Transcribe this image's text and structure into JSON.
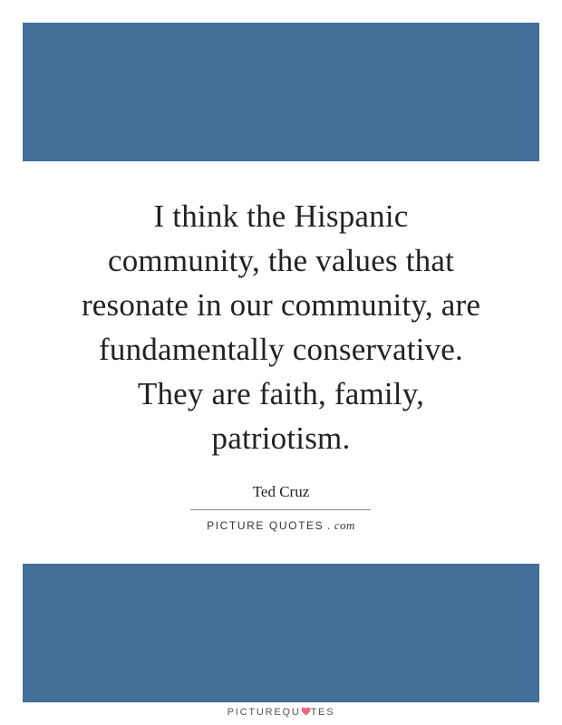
{
  "colors": {
    "band": "#446f99",
    "heart": "#e76b86"
  },
  "quote": {
    "lines": [
      "I think the Hispanic",
      "community, the values that",
      "resonate in our community, are",
      "fundamentally conservative.",
      "They are faith, family,",
      "patriotism."
    ]
  },
  "author": "Ted Cruz",
  "site_mark": {
    "word": "PICTURE QUOTES",
    "tld": ". com"
  },
  "footer": {
    "left": "PICTUREQU",
    "icon": "heart-icon",
    "right": "TES"
  }
}
